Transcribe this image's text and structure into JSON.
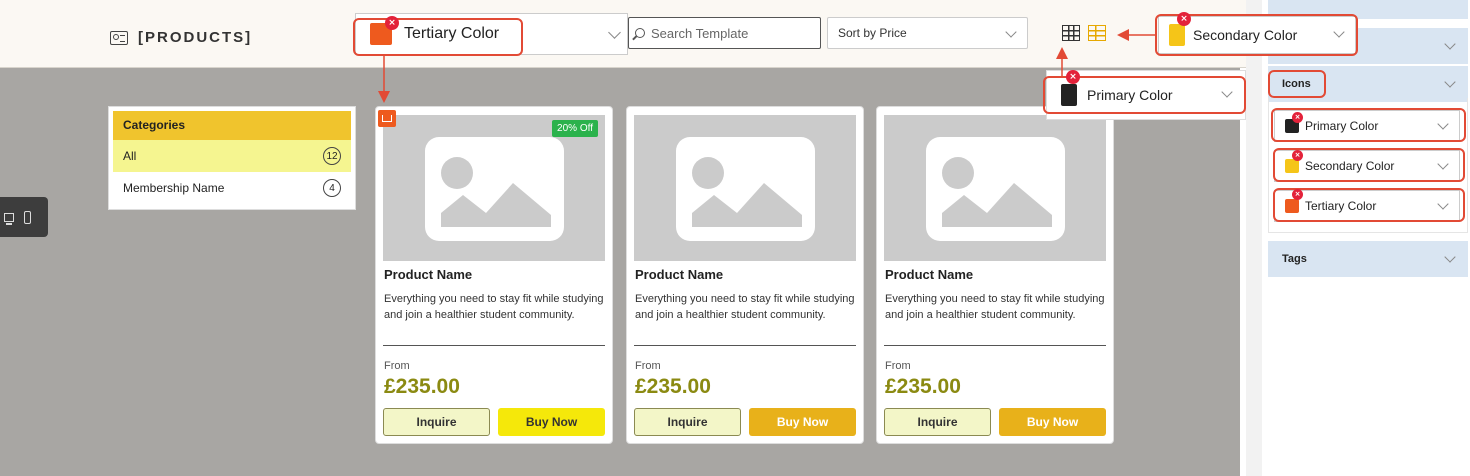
{
  "header": {
    "title": "[PRODUCTS]",
    "search_placeholder": "Search Template",
    "sort_label": "Sort by Price"
  },
  "categories": {
    "heading": "Categories",
    "items": [
      {
        "label": "All",
        "count": "12"
      },
      {
        "label": "Membership Name",
        "count": "4"
      }
    ]
  },
  "products": [
    {
      "name": "Product Name",
      "description": "Everything you need to stay fit while studying and join a healthier student community.",
      "from_label": "From",
      "price": "£235.00",
      "inquire": "Inquire",
      "buy": "Buy Now",
      "discount": "20% Off"
    },
    {
      "name": "Product Name",
      "description": "Everything you need to stay fit while studying and join a healthier student community.",
      "from_label": "From",
      "price": "£235.00",
      "inquire": "Inquire",
      "buy": "Buy Now"
    },
    {
      "name": "Product Name",
      "description": "Everything you need to stay fit while studying and join a healthier student community.",
      "from_label": "From",
      "price": "£235.00",
      "inquire": "Inquire",
      "buy": "Buy Now"
    }
  ],
  "callouts": {
    "tertiary": "Tertiary Color",
    "secondary": "Secondary Color",
    "primary": "Primary Color",
    "remove_glyph": "×"
  },
  "panel": {
    "icons_section": "Icons",
    "tags_section": "Tags",
    "color_items": [
      "Primary Color",
      "Secondary Color",
      "Tertiary Color"
    ]
  },
  "colors": {
    "primary": "#222222",
    "secondary": "#f5c518",
    "tertiary": "#ee5a1e",
    "annotation": "#e24a35",
    "price": "#8b8a12"
  },
  "icons": [
    "profile-card-icon",
    "search-icon",
    "chevron-down-icon",
    "grid-view-icon",
    "table-view-icon",
    "monitor-icon",
    "phone-icon",
    "crown-icon",
    "image-placeholder-icon",
    "remove-icon"
  ]
}
